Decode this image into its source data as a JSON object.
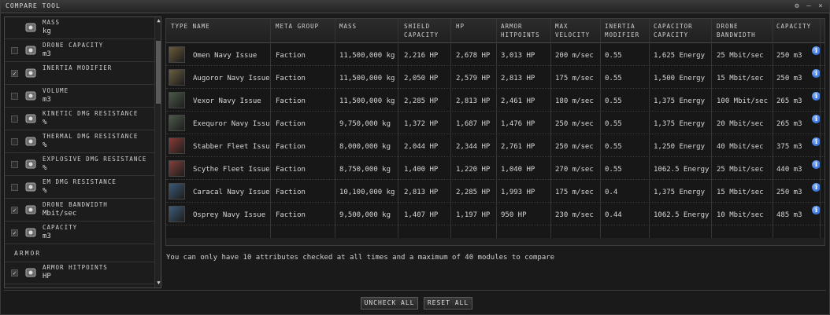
{
  "window": {
    "title": "COMPARE TOOL",
    "controls": [
      "gear-icon",
      "minimize-icon",
      "close-icon"
    ]
  },
  "attributes": [
    {
      "name": "MASS",
      "unit": "kg",
      "checked": false,
      "icon": "mass-icon",
      "show_checkbox": false
    },
    {
      "name": "DRONE CAPACITY",
      "unit": "m3",
      "checked": false,
      "icon": "drone-capacity-icon",
      "show_checkbox": true
    },
    {
      "name": "INERTIA MODIFIER",
      "unit": "",
      "checked": true,
      "icon": "inertia-icon",
      "show_checkbox": true
    },
    {
      "name": "VOLUME",
      "unit": "m3",
      "checked": false,
      "icon": "volume-icon",
      "show_checkbox": true
    },
    {
      "name": "KINETIC DMG RESISTANCE",
      "unit": "%",
      "checked": false,
      "icon": "kinetic-resist-icon",
      "show_checkbox": true
    },
    {
      "name": "THERMAL DMG RESISTANCE",
      "unit": "%",
      "checked": false,
      "icon": "thermal-resist-icon",
      "show_checkbox": true
    },
    {
      "name": "EXPLOSIVE DMG RESISTANCE",
      "unit": "%",
      "checked": false,
      "icon": "explosive-resist-icon",
      "show_checkbox": true
    },
    {
      "name": "EM DMG RESISTANCE",
      "unit": "%",
      "checked": false,
      "icon": "em-resist-icon",
      "show_checkbox": true
    },
    {
      "name": "DRONE BANDWIDTH",
      "unit": "Mbit/sec",
      "checked": true,
      "icon": "drone-bandwidth-icon",
      "show_checkbox": true
    },
    {
      "name": "CAPACITY",
      "unit": "m3",
      "checked": true,
      "icon": "capacity-icon",
      "show_checkbox": true
    }
  ],
  "section_armor": "ARMOR",
  "armor_attributes": [
    {
      "name": "ARMOR HITPOINTS",
      "unit": "HP",
      "checked": true,
      "icon": "armor-hp-icon",
      "show_checkbox": true
    }
  ],
  "table": {
    "headers": [
      [
        "TYPE NAME"
      ],
      [
        "META GROUP"
      ],
      [
        "MASS"
      ],
      [
        "SHIELD",
        "CAPACITY"
      ],
      [
        "HP"
      ],
      [
        "ARMOR",
        "HITPOINTS"
      ],
      [
        "MAX",
        "VELOCITY"
      ],
      [
        "INERTIA",
        "MODIFIER"
      ],
      [
        "CAPACITOR",
        "CAPACITY"
      ],
      [
        "DRONE",
        "BANDWIDTH"
      ],
      [
        "CAPACITY"
      ]
    ],
    "rows": [
      {
        "name": "Omen Navy Issue",
        "meta": "Faction",
        "mass": "11,500,000 kg",
        "shield": "2,216 HP",
        "hp": "2,678 HP",
        "armor": "3,013 HP",
        "velocity": "200 m/sec",
        "inertia": "0.55",
        "capacitor": "1,625 Energy",
        "bandwidth": "25 Mbit/sec",
        "capacity": "250 m3",
        "thumb_color": "#6a5a3a"
      },
      {
        "name": "Augoror Navy Issue",
        "meta": "Faction",
        "mass": "11,500,000 kg",
        "shield": "2,050 HP",
        "hp": "2,579 HP",
        "armor": "2,813 HP",
        "velocity": "175 m/sec",
        "inertia": "0.55",
        "capacitor": "1,500 Energy",
        "bandwidth": "15 Mbit/sec",
        "capacity": "250 m3",
        "thumb_color": "#6b5e40"
      },
      {
        "name": "Vexor Navy Issue",
        "meta": "Faction",
        "mass": "11,500,000 kg",
        "shield": "2,285 HP",
        "hp": "2,813 HP",
        "armor": "2,461 HP",
        "velocity": "180 m/sec",
        "inertia": "0.55",
        "capacitor": "1,375 Energy",
        "bandwidth": "100 Mbit/sec",
        "capacity": "265 m3",
        "thumb_color": "#4a5a48"
      },
      {
        "name": "Exequror Navy Issue",
        "meta": "Faction",
        "mass": "9,750,000 kg",
        "shield": "1,372 HP",
        "hp": "1,687 HP",
        "armor": "1,476 HP",
        "velocity": "250 m/sec",
        "inertia": "0.55",
        "capacitor": "1,375 Energy",
        "bandwidth": "20 Mbit/sec",
        "capacity": "265 m3",
        "thumb_color": "#4c5a4a"
      },
      {
        "name": "Stabber Fleet Issue",
        "meta": "Faction",
        "mass": "8,000,000 kg",
        "shield": "2,044 HP",
        "hp": "2,344 HP",
        "armor": "2,761 HP",
        "velocity": "250 m/sec",
        "inertia": "0.55",
        "capacitor": "1,250 Energy",
        "bandwidth": "40 Mbit/sec",
        "capacity": "375 m3",
        "thumb_color": "#8a3a36"
      },
      {
        "name": "Scythe Fleet Issue",
        "meta": "Faction",
        "mass": "8,750,000 kg",
        "shield": "1,400 HP",
        "hp": "1,220 HP",
        "armor": "1,040 HP",
        "velocity": "270 m/sec",
        "inertia": "0.55",
        "capacitor": "1062.5 Energy",
        "bandwidth": "25 Mbit/sec",
        "capacity": "440 m3",
        "thumb_color": "#84403a"
      },
      {
        "name": "Caracal Navy Issue",
        "meta": "Faction",
        "mass": "10,100,000 kg",
        "shield": "2,813 HP",
        "hp": "2,285 HP",
        "armor": "1,993 HP",
        "velocity": "175 m/sec",
        "inertia": "0.4",
        "capacitor": "1,375 Energy",
        "bandwidth": "15 Mbit/sec",
        "capacity": "250 m3",
        "thumb_color": "#3a5a78"
      },
      {
        "name": "Osprey Navy Issue",
        "meta": "Faction",
        "mass": "9,500,000 kg",
        "shield": "1,407 HP",
        "hp": "1,197 HP",
        "armor": "950 HP",
        "velocity": "230 m/sec",
        "inertia": "0.44",
        "capacitor": "1062.5 Energy",
        "bandwidth": "10 Mbit/sec",
        "capacity": "485 m3",
        "thumb_color": "#3c5c7a"
      }
    ]
  },
  "note": "You can only have 10 attributes checked at all times and a maximum of 40 modules to compare",
  "buttons": {
    "uncheck_all": "UNCHECK ALL",
    "reset_all": "RESET ALL"
  },
  "colors": {
    "background": "#1a1a1a",
    "info_icon": "#2f6fe0",
    "text": "#d6d6d6"
  }
}
